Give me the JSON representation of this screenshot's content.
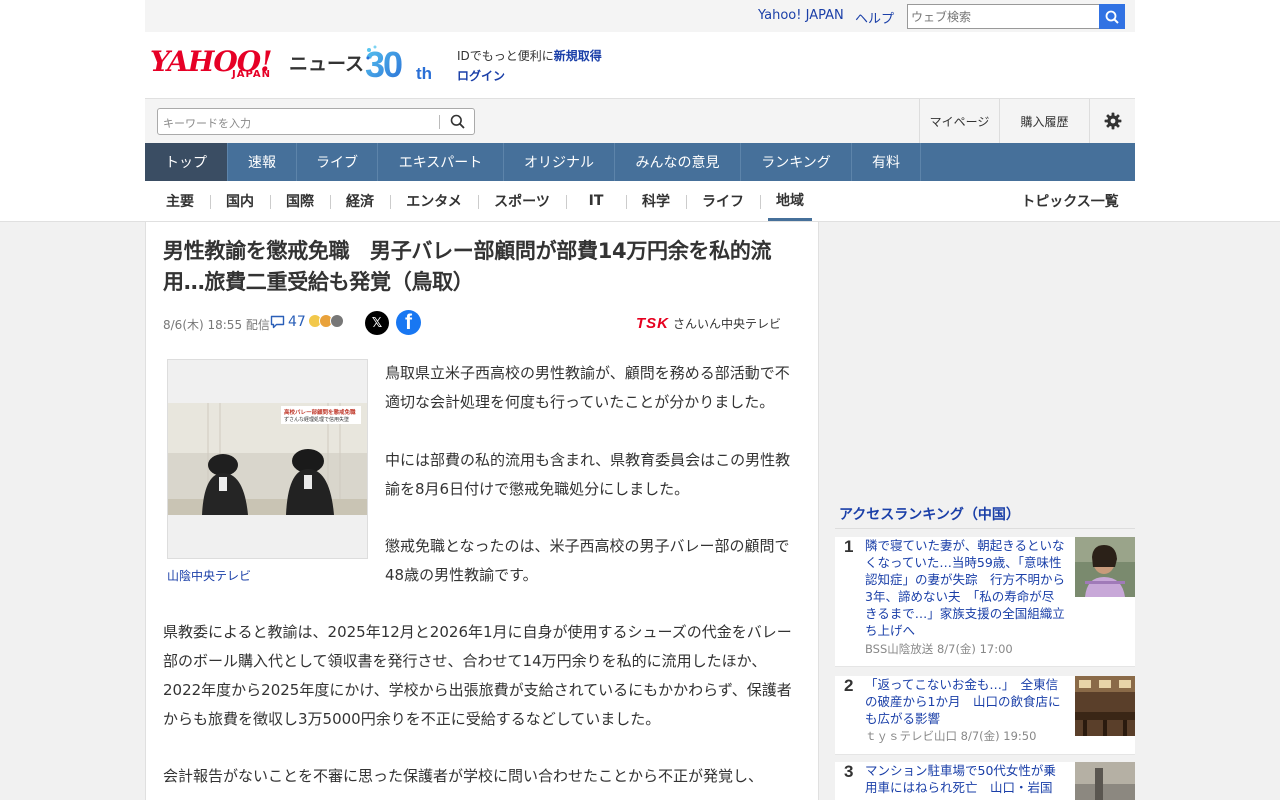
{
  "utility": {
    "yahoo_japan": "Yahoo! JAPAN",
    "help": "ヘルプ",
    "web_search_placeholder": "ウェブ検索"
  },
  "brand": {
    "logo": "YAHOO!",
    "logo_sub": "JAPAN",
    "service": "ニュース",
    "anniversary": "30th",
    "id_prompt": "IDでもっと便利に",
    "signup": "新規取得",
    "login": "ログイン"
  },
  "search": {
    "placeholder": "キーワードを入力",
    "mypage": "マイページ",
    "purchase_history": "購入履歴"
  },
  "global_nav": [
    "トップ",
    "速報",
    "ライブ",
    "エキスパート",
    "オリジナル",
    "みんなの意見",
    "ランキング",
    "有料"
  ],
  "category_nav": [
    "主要",
    "国内",
    "国際",
    "経済",
    "エンタメ",
    "スポーツ",
    "IT",
    "科学",
    "ライフ",
    "地域"
  ],
  "topics_list": "トピックス一覧",
  "article": {
    "title": "男性教諭を懲戒免職　男子バレー部顧問が部費14万円余を私的流用…旅費二重受給も発覚（鳥取）",
    "date": "8/6(木) 18:55",
    "distributed": "配信",
    "comment_count": "47",
    "source_logo": "TSK",
    "source_name": "さんいん中央テレビ",
    "photo_credit": "山陰中央テレビ",
    "photo_caption_line1": "高校バレー部顧問を懲戒免職",
    "photo_caption_line2": "ずさんな経理処理で信用失墜",
    "p1": "鳥取県立米子西高校の男性教諭が、顧問を務める部活動で不適切な会計処理を何度も行っていたことが分かりました。",
    "p2": "中には部費の私的流用も含まれ、県教育委員会はこの男性教諭を8月6日付けで懲戒免職処分にしました。",
    "p3": "懲戒免職となったのは、米子西高校の男子バレー部の顧問で48歳の男性教諭です。",
    "p4": "県教委によると教諭は、2025年12月と2026年1月に自身が使用するシューズの代金をバレー部のボール購入代として領収書を発行させ、合わせて14万円余りを私的に流用したほか、2022年度から2025年度にかけ、学校から出張旅費が支給されているにもかかわらず、保護者からも旅費を徴収し3万5000円余りを不正に受給するなどしていました。",
    "p5": "会計報告がないことを不審に思った保護者が学校に問い合わせたことから不正が発覚し、"
  },
  "ranking": {
    "heading": "アクセスランキング（中国）",
    "items": [
      {
        "rank": "1",
        "title": "隣で寝ていた妻が、朝起きるといなくなっていた…当時59歳、「意味性認知症」の妻が失踪　行方不明から3年、諦めない夫　「私の寿命が尽きるまで…」家族支援の全国組織立ち上げへ",
        "source": "BSS山陰放送 8/7(金) 17:00"
      },
      {
        "rank": "2",
        "title": "「返ってこないお金も…」　全東信の破産から1か月　山口の飲食店にも広がる影響",
        "source": "ｔｙｓテレビ山口 8/7(金) 19:50"
      },
      {
        "rank": "3",
        "title": "マンション駐車場で50代女性が乗用車にはねられ死亡　山口・岩国",
        "source": ""
      }
    ]
  },
  "colors": {
    "nav_blue": "#46709a",
    "nav_active": "#3a4d63",
    "link_blue": "#1a3fa8",
    "brand_red": "#e60026"
  }
}
